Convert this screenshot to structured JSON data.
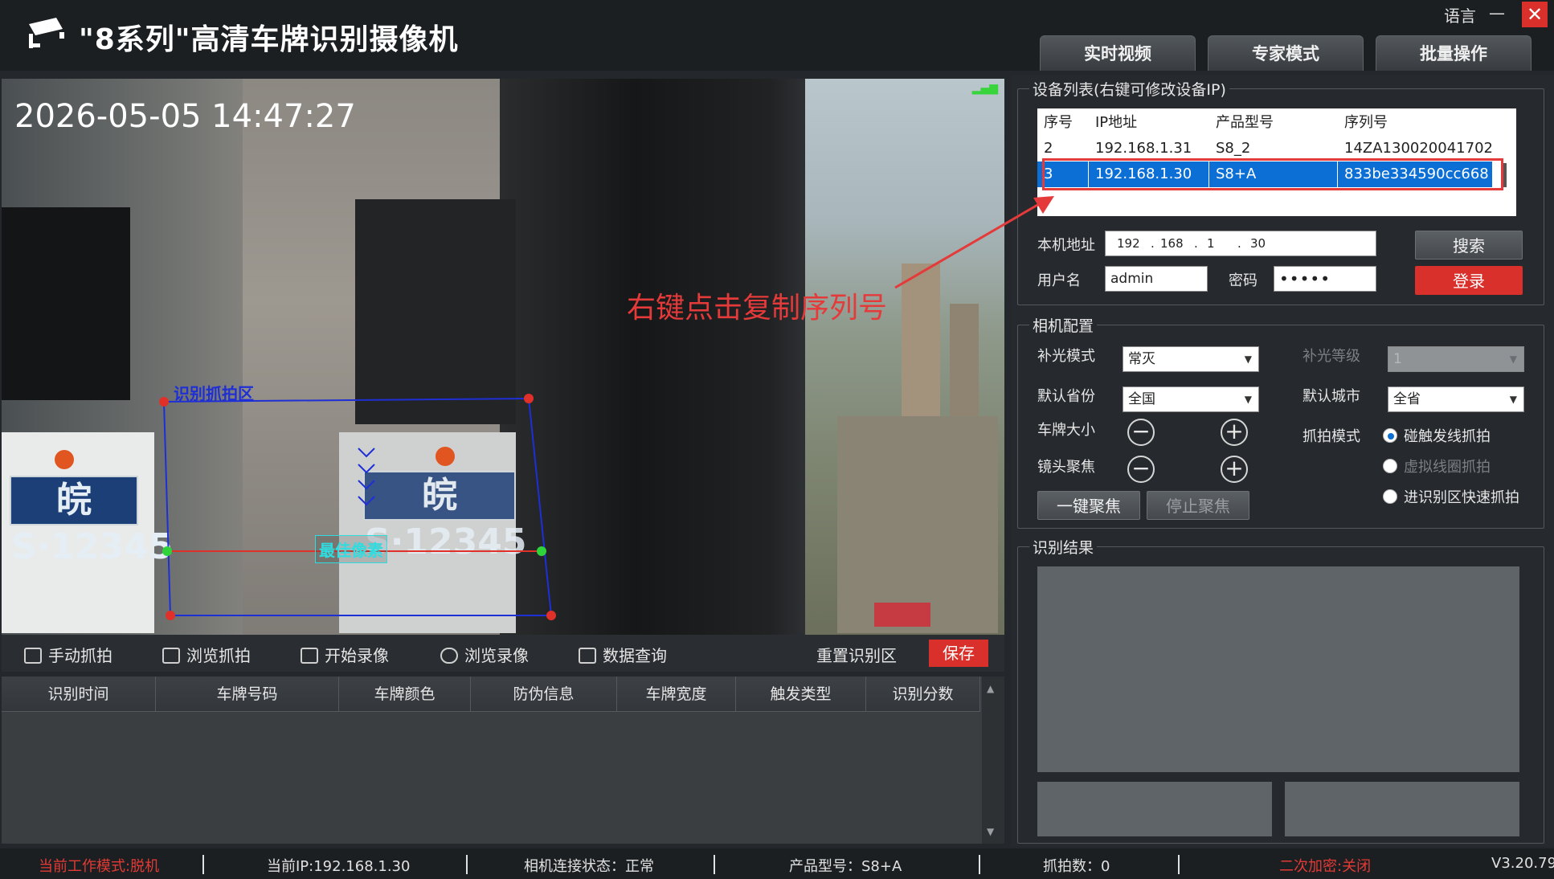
{
  "app": {
    "title": "\"8系列\"高清车牌识别摄像机",
    "language_label": "语言",
    "minimize_label": "—",
    "close_label": "✕",
    "logo_icon": "cctv-camera-icon"
  },
  "tabs": [
    {
      "label": "实时视频",
      "active": true
    },
    {
      "label": "专家模式",
      "active": false
    },
    {
      "label": "批量操作",
      "active": false
    }
  ],
  "video": {
    "timestamp": "2026-05-05 14:47:27",
    "zone_label": "识别抓拍区",
    "best_pixel_label": "最佳像素",
    "plate_left": "皖S·12345",
    "plate_right": "皖S·12345",
    "signal_icon": "signal-bars-icon"
  },
  "video_toolbar": {
    "manual_snap": "手动抓拍",
    "browse_snap": "浏览抓拍",
    "start_record": "开始录像",
    "browse_record": "浏览录像",
    "data_query": "数据查询",
    "reset_zone": "重置识别区",
    "save": "保存"
  },
  "result_table": {
    "columns": [
      "识别时间",
      "车牌号码",
      "车牌颜色",
      "防伪信息",
      "车牌宽度",
      "触发类型",
      "识别分数"
    ],
    "rows": []
  },
  "device_list": {
    "title": "设备列表(右键可修改设备IP)",
    "columns": [
      "序号",
      "IP地址",
      "产品型号",
      "序列号"
    ],
    "rows": [
      {
        "index": "2",
        "ip": "192.168.1.31",
        "model": "S8_2",
        "serial": "14ZA130020041702",
        "selected": false
      },
      {
        "index": "3",
        "ip": "192.168.1.30",
        "model": "S8+A",
        "serial": "833be334590cc668",
        "selected": true
      }
    ],
    "annotation": "右键点击复制序列号"
  },
  "login": {
    "local_addr_label": "本机地址",
    "ip_parts": [
      "192",
      "168",
      "1",
      "30"
    ],
    "username_label": "用户名",
    "username": "admin",
    "password_label": "密码",
    "password_mask": "•••••",
    "search": "搜索",
    "login": "登录"
  },
  "camera_config": {
    "title": "相机配置",
    "fill_light_mode_label": "补光模式",
    "fill_light_mode": "常灭",
    "fill_light_level_label": "补光等级",
    "fill_light_level": "1",
    "default_province_label": "默认省份",
    "default_province": "全国",
    "default_city_label": "默认城市",
    "default_city": "全省",
    "plate_size_label": "车牌大小",
    "lens_focus_label": "镜头聚焦",
    "capture_mode_label": "抓拍模式",
    "capture_modes": [
      {
        "label": "碰触发线抓拍",
        "selected": true
      },
      {
        "label": "虚拟线圈抓拍",
        "selected": false
      },
      {
        "label": "进识别区快速抓拍",
        "selected": false
      }
    ],
    "auto_focus": "一键聚焦",
    "stop_focus": "停止聚焦"
  },
  "recognition_result": {
    "title": "识别结果"
  },
  "status_bar": {
    "work_mode": "当前工作模式:脱机",
    "current_ip": "当前IP:192.168.1.30",
    "connection": "相机连接状态：正常",
    "model": "产品型号：S8+A",
    "capture_count": "抓拍数：0",
    "encryption": "二次加密:关闭",
    "version": "V3.20.79"
  },
  "colors": {
    "accent_red": "#d9302b",
    "selection_blue": "#0b6fd6",
    "zone_blue": "#1e2fd6",
    "best_cyan": "#2fdde0"
  }
}
